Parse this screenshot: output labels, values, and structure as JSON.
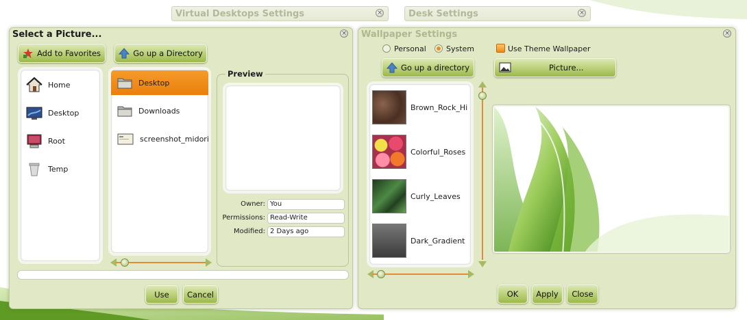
{
  "background_windows": [
    {
      "title": "Virtual Desktops Settings"
    },
    {
      "title": "Desk Settings"
    }
  ],
  "picker": {
    "title": "Select a Picture...",
    "add_favorites": "Add to Favorites",
    "go_up": "Go up a Directory",
    "places": [
      {
        "label": "Home",
        "icon": "home-icon"
      },
      {
        "label": "Desktop",
        "icon": "desktop-icon"
      },
      {
        "label": "Root",
        "icon": "computer-icon"
      },
      {
        "label": "Temp",
        "icon": "trash-icon"
      }
    ],
    "files": [
      {
        "label": "Desktop",
        "icon": "folder-icon",
        "selected": true
      },
      {
        "label": "Downloads",
        "icon": "folder-icon",
        "selected": false
      },
      {
        "label": "screenshot_midori.",
        "icon": "image-file-icon",
        "selected": false
      }
    ],
    "preview": {
      "title": "Preview",
      "owner_label": "Owner:",
      "owner_value": "You",
      "permissions_label": "Permissions:",
      "permissions_value": "Read-Write",
      "modified_label": "Modified:",
      "modified_value": "2 Days ago"
    },
    "path_value": "",
    "use_button": "Use",
    "cancel_button": "Cancel"
  },
  "wallpaper": {
    "title": "Wallpaper Settings",
    "personal_label": "Personal",
    "system_label": "System",
    "selected_source": "System",
    "use_theme_label": "Use Theme Wallpaper",
    "use_theme_checked": true,
    "go_up": "Go up a directory",
    "picture_button": "Picture...",
    "items": [
      {
        "label": "Brown_Rock_Hi",
        "thumb": "#6b4a3a"
      },
      {
        "label": "Colorful_Roses",
        "thumb": "#d9526b"
      },
      {
        "label": "Curly_Leaves",
        "thumb": "#3f6b3a"
      },
      {
        "label": "Dark_Gradient",
        "thumb": "#555555"
      }
    ],
    "ok_button": "OK",
    "apply_button": "Apply",
    "close_button": "Close"
  },
  "colors": {
    "accent_orange": "#ee8a1a",
    "button_green": "#9db84c",
    "dialog_bg": "#e1e8c6"
  }
}
